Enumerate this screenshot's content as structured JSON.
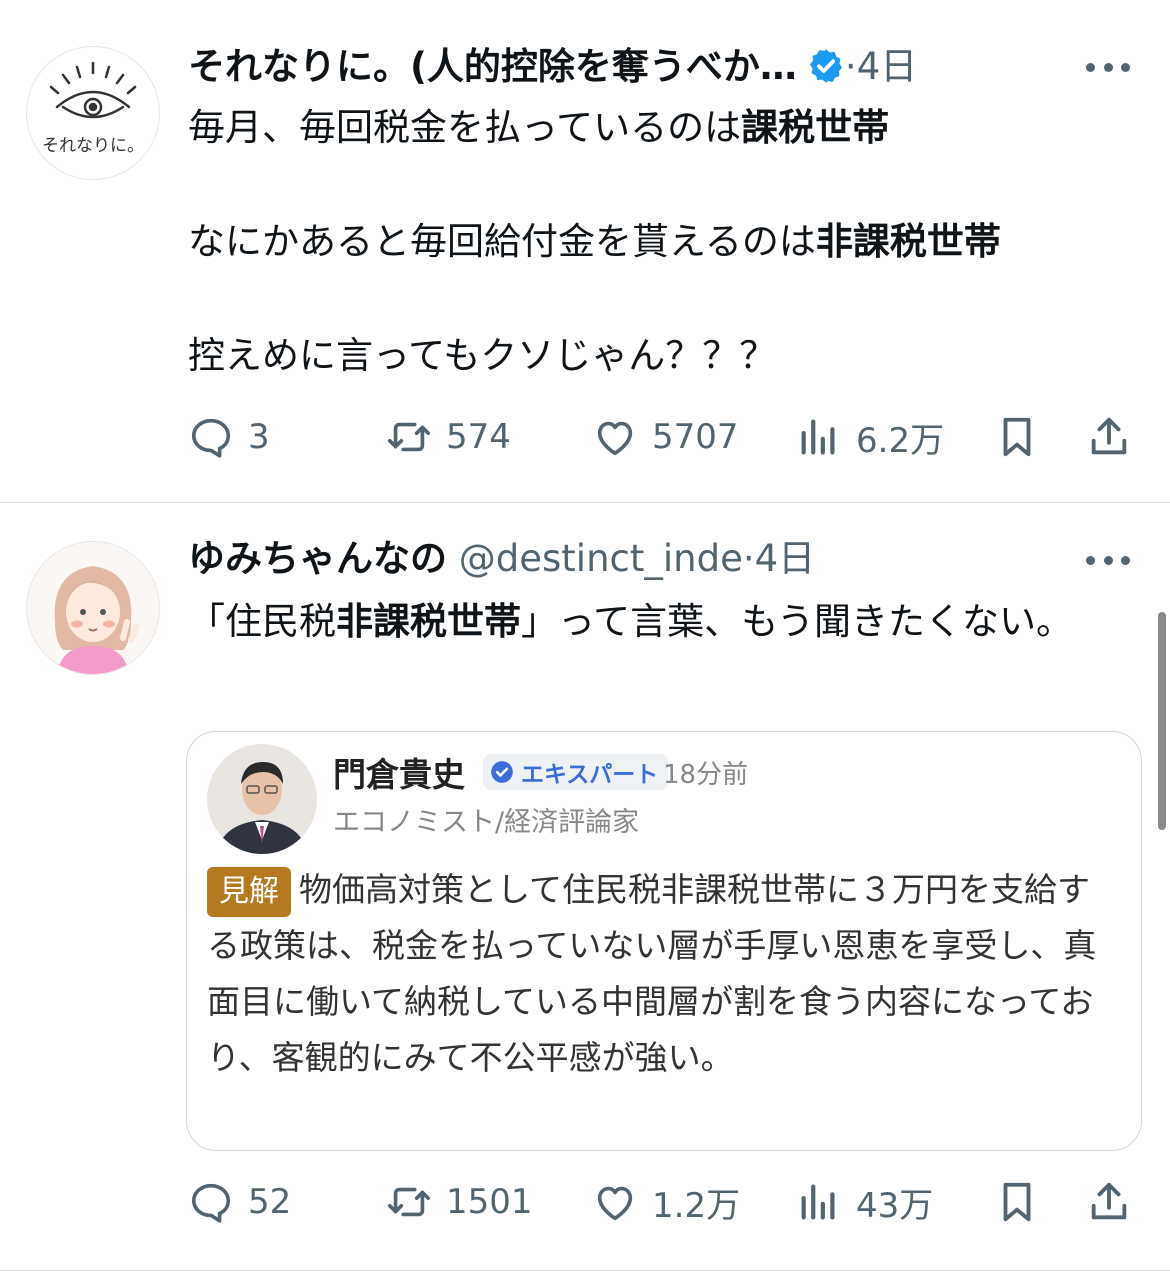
{
  "tweets": [
    {
      "avatar_text": "それなりに。",
      "name": "それなりに。(人的控除を奪うべか…",
      "handle": "",
      "dot": "·",
      "time": "4日",
      "lines": [
        {
          "pre": "毎月、毎回税金を払っているのは",
          "bold": "課税世帯"
        },
        {
          "pre": "なにかあると毎回給付金を貰えるのは",
          "bold": "非課税世帯"
        },
        {
          "pre": "控えめに言ってもクソじゃん？？？",
          "bold": ""
        }
      ],
      "stats": {
        "replies": "3",
        "retweets": "574",
        "likes": "5707",
        "views": "6.2万"
      }
    },
    {
      "name": "ゆみちゃんなの",
      "handle": "@destinct_inde",
      "dot": "·",
      "time": "4日",
      "text_pre": "「住民税",
      "text_bold": "非課税世帯",
      "text_post": "」って言葉、もう聞きたくない。",
      "quote": {
        "name": "門倉貴史",
        "badge": "エキスパート",
        "time": "18分前",
        "role": "エコノミスト/経済評論家",
        "tag": "見解",
        "text": "物価高対策として住民税非課税世帯に３万円を支給する政策は、税金を払っていない層が手厚い恩恵を享受し、真面目に働いて納税している中間層が割を食う内容になっており、客観的にみて不公平感が強い。"
      },
      "stats": {
        "replies": "52",
        "retweets": "1501",
        "likes": "1.2万",
        "views": "43万"
      }
    }
  ],
  "colors": {
    "icon": "#536471",
    "verified": "#1d9bf0",
    "tag": "#b5791f",
    "divider": "#e1e4e8"
  },
  "icons": [
    "reply-icon",
    "retweet-icon",
    "like-icon",
    "views-icon",
    "bookmark-icon",
    "share-icon",
    "verified-icon",
    "more-icon"
  ]
}
